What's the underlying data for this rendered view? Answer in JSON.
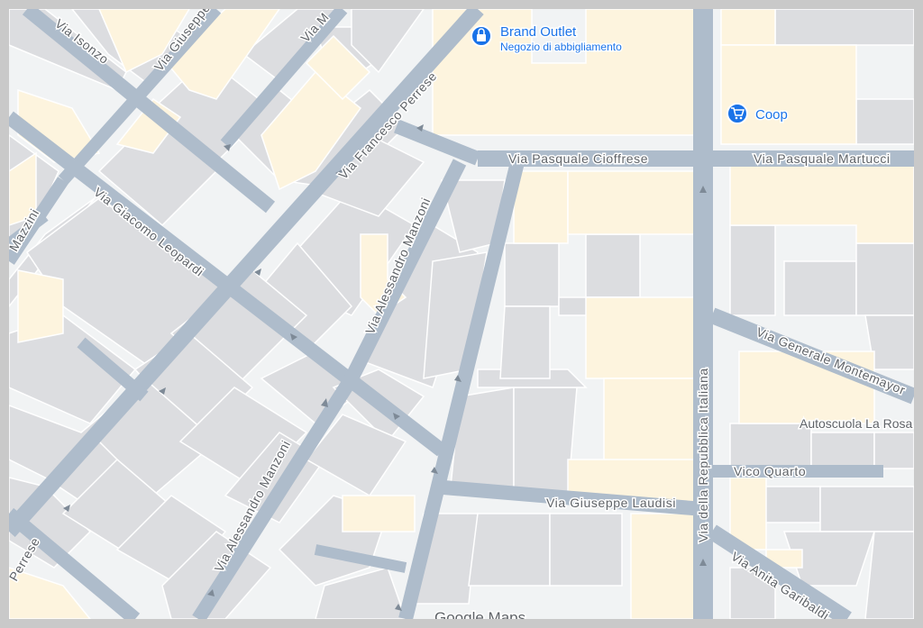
{
  "colors": {
    "background": "#f1f3f4",
    "road": "#aebccb",
    "building": "#dcdde0",
    "commercial": "#fdf4de",
    "poi": "#1a73e8",
    "label": "#5f6368"
  },
  "streets": {
    "isonzo": "Via Isonzo",
    "giuseppe_top": "Via Giuseppe",
    "via_m_top": "Via M",
    "francesco_perrese": "Via Francesco Perrese",
    "mazzini": "Mazzini",
    "giacomo_leopardi": "Via Giacomo Leopardi",
    "alessandro_manzoni_north": "Via Alessandro Manzoni",
    "alessandro_manzoni_south": "Via Alessandro Manzoni",
    "pasquale_cioffrese": "Via Pasquale Cioffrese",
    "pasquale_martucci": "Via Pasquale Martucci",
    "repubblica_italiana": "Via della Repubblica Italiana",
    "generale_montemayor": "Via Generale Montemayor",
    "vico_quarto": "Vico Quarto",
    "giuseppe_laudisi": "Via Giuseppe Laudisi",
    "anita_garibaldi": "Via Anita Garibaldi",
    "perrese_bottom": "Perrese"
  },
  "pois": {
    "brand_outlet": {
      "name": "Brand Outlet",
      "category": "Negozio di abbigliamento",
      "icon": "shopping-bag-icon"
    },
    "coop": {
      "name": "Coop",
      "icon": "shopping-cart-icon"
    }
  },
  "businesses": {
    "autoscuola": "Autoscuola La Rosa"
  },
  "attribution": {
    "logo": "Google Maps"
  }
}
